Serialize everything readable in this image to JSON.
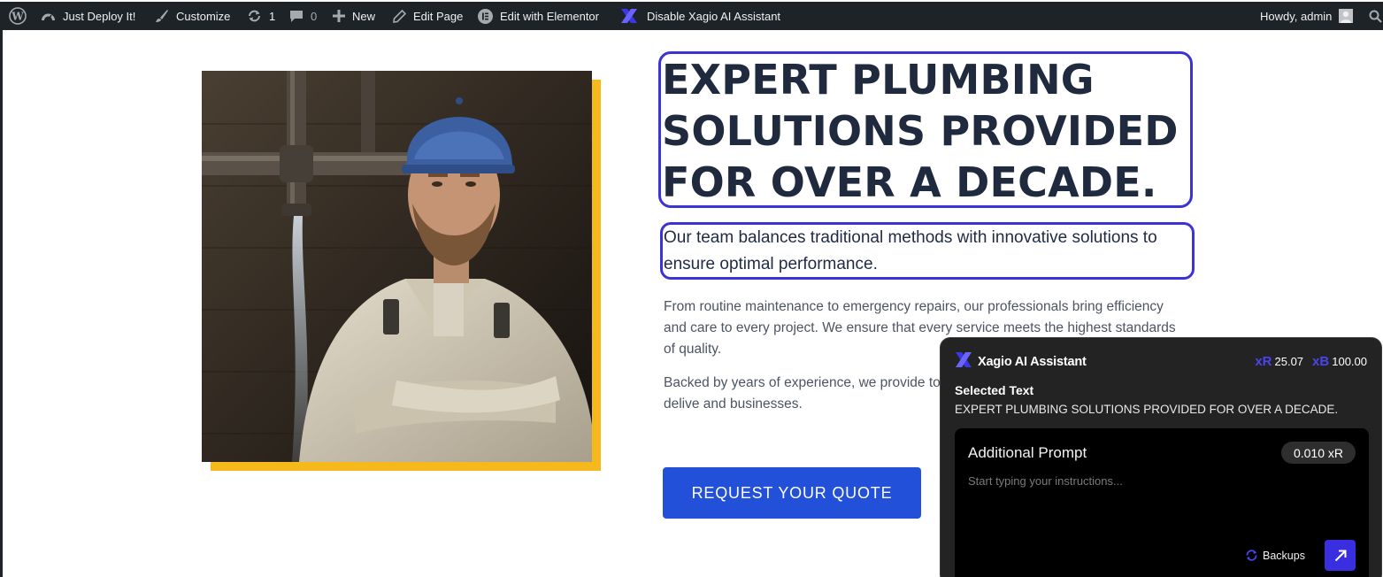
{
  "adminbar": {
    "site_name": "Just Deploy It!",
    "customize": "Customize",
    "updates_count": "1",
    "comments_count": "0",
    "new": "New",
    "edit_page": "Edit Page",
    "edit_elementor": "Edit with Elementor",
    "xagio_toggle": "Disable Xagio AI Assistant",
    "howdy": "Howdy, admin"
  },
  "hero": {
    "headline_lines": [
      "EXPERT PLUMBING",
      "SOLUTIONS PROVIDED",
      "FOR OVER A DECADE."
    ],
    "subheading": "Our team balances traditional methods with innovative solutions to ensure optimal performance.",
    "paragraph_1": "From routine maintenance to emergency repairs, our professionals bring efficiency and care to every project. We ensure that every service meets the highest standards of quality.",
    "paragraph_2": "Backed by years of experience, we provide to technology with traditional expertise to delive and businesses.",
    "cta_label": "REQUEST YOUR QUOTE"
  },
  "xagio_panel": {
    "title": "Xagio AI Assistant",
    "credits_r": "25.07",
    "credits_b": "100.00",
    "credits_r_symbol": "xR",
    "credits_b_symbol": "xB",
    "selected_label": "Selected Text",
    "selected_text": "EXPERT PLUMBING SOLUTIONS PROVIDED FOR OVER A DECADE.",
    "prompt_label": "Additional Prompt",
    "prompt_cost": "0.010 xR",
    "prompt_placeholder": "Start typing your instructions...",
    "backups_label": "Backups"
  },
  "colors": {
    "accent_blue": "#2250d9",
    "highlight_border": "#3a33d6",
    "image_frame": "#f6b91c",
    "adminbar_bg": "#1d2327"
  }
}
